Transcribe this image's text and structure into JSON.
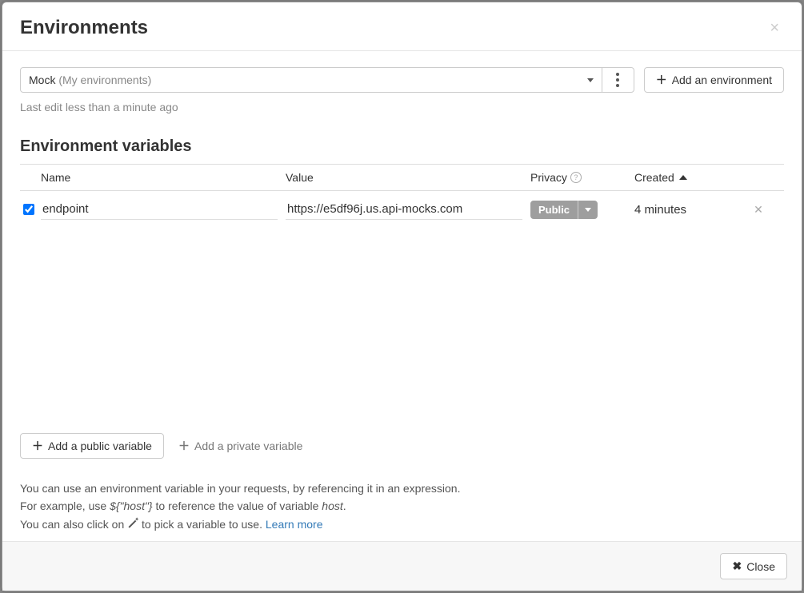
{
  "modal": {
    "title": "Environments"
  },
  "envSelector": {
    "name": "Mock",
    "scope": "(My environments)",
    "addLabel": "Add an environment"
  },
  "lastEdit": "Last edit less than a minute ago",
  "sectionTitle": "Environment variables",
  "columns": {
    "name": "Name",
    "value": "Value",
    "privacy": "Privacy",
    "created": "Created"
  },
  "variables": [
    {
      "checked": true,
      "name": "endpoint",
      "value": "https://e5df96j.us.api-mocks.com",
      "privacy": "Public",
      "created": "4 minutes"
    }
  ],
  "addButtons": {
    "public": "Add a public variable",
    "private": "Add a private variable"
  },
  "help": {
    "line1": "You can use an environment variable in your requests, by referencing it in an expression.",
    "line2a": "For example, use ",
    "line2_expr": "${\"host\"}",
    "line2b": " to reference the value of variable ",
    "line2_var": "host",
    "line2c": ".",
    "line3a": "You can also click on ",
    "line3b": " to pick a variable to use. ",
    "learnMore": "Learn more"
  },
  "footer": {
    "close": "Close"
  }
}
